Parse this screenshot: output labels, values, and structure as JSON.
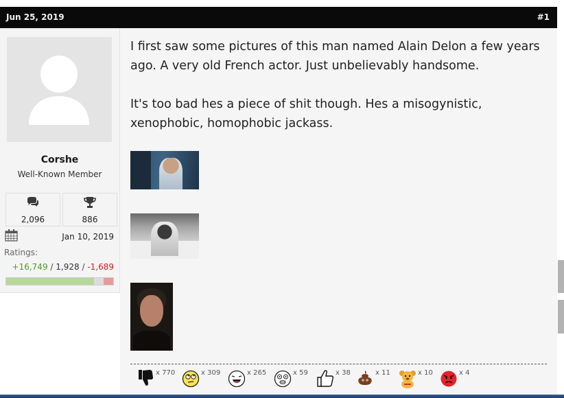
{
  "post": {
    "date": "Jun 25, 2019",
    "number": "#1"
  },
  "user": {
    "name": "Corshe",
    "title": "Well-Known Member",
    "messages": "2,096",
    "trophies": "886",
    "joined": "Jan 10, 2019",
    "ratings_label": "Ratings:",
    "ratings_positive": "+16,749",
    "ratings_neutral": "1,928",
    "ratings_negative": "-1,689",
    "ratings_bar": {
      "positive": 0.82,
      "neutral": 0.09,
      "negative": 0.09
    },
    "colors": {
      "positive": "#b8d89a",
      "neutral": "#dcdcdc",
      "negative": "#e89a9a"
    }
  },
  "message": {
    "paragraph1": "I first saw some pictures of this man named Alain Delon a few years ago. A very old French actor. Just unbelievably handsome.",
    "paragraph2": "It's too bad hes a piece of shit though. Hes a misogynistic, xenophobic, homophobic jackass."
  },
  "images": [
    {
      "icon": "photo-man-on-street"
    },
    {
      "icon": "photo-black-and-white-man"
    },
    {
      "icon": "photo-portrait"
    }
  ],
  "reactions": [
    {
      "icon": "thumbs-down-icon",
      "count": "x 770"
    },
    {
      "icon": "eye-roll-smiley-icon",
      "count": "x 309"
    },
    {
      "icon": "laughing-smiley-icon",
      "count": "x 265"
    },
    {
      "icon": "dizzy-smiley-icon",
      "count": "x 59"
    },
    {
      "icon": "thumbs-up-icon",
      "count": "x 38"
    },
    {
      "icon": "poop-icon",
      "count": "x 11"
    },
    {
      "icon": "teddy-bear-icon",
      "count": "x 10"
    },
    {
      "icon": "angry-face-icon",
      "count": "x 4"
    }
  ]
}
